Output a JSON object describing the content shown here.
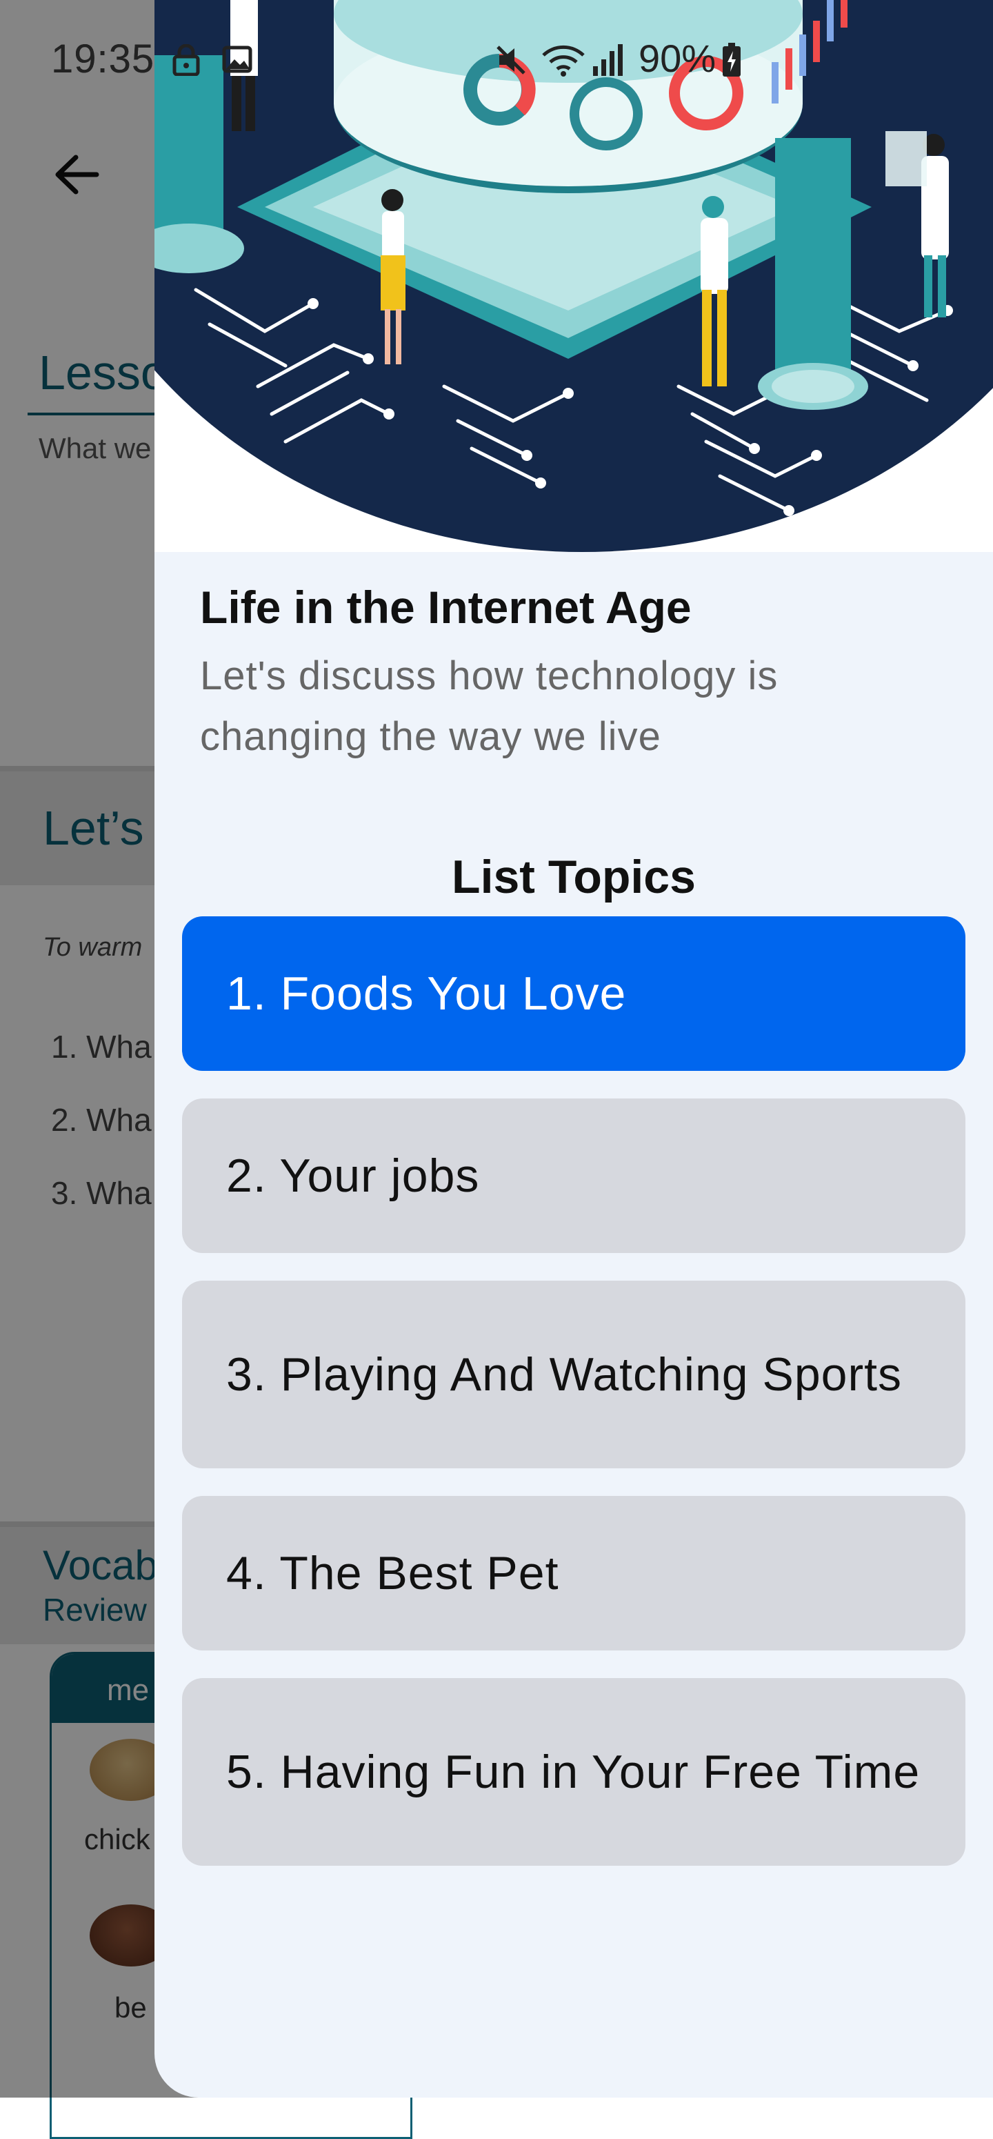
{
  "status_bar": {
    "time": "19:35",
    "battery": "90%",
    "icons": [
      "lock-icon",
      "image-icon",
      "mute-icon",
      "wifi-icon",
      "signal-icon",
      "battery-charging-icon"
    ]
  },
  "background": {
    "lesson_title": "Lesso",
    "lesson_subtitle": "What we",
    "lets_title": "Let’s",
    "warm_text": "To warm",
    "questions": [
      "1. Wha",
      "2. Wha",
      "3. Wha"
    ],
    "vocab_title": "Vocab",
    "vocab_review": "Review",
    "vocab_card_header": "me",
    "vocab_words": [
      "chick",
      "be"
    ]
  },
  "drawer": {
    "title": "Life in the Internet Age",
    "subtitle": "Let's discuss how technology is changing the way we live",
    "list_heading": "List Topics",
    "topics": [
      {
        "label": "1. Foods You Love",
        "selected": true
      },
      {
        "label": "2. Your jobs",
        "selected": false
      },
      {
        "label": "3. Playing And Watching Sports",
        "selected": false
      },
      {
        "label": "4. The Best Pet",
        "selected": false
      },
      {
        "label": "5. Having Fun in Your Free Time",
        "selected": false
      }
    ]
  },
  "colors": {
    "accent": "#0066ee",
    "topic_bg": "#d6d8de",
    "drawer_bg": "#eff4fb",
    "hero_navy": "#14284a",
    "teal": "#0d5f73"
  }
}
